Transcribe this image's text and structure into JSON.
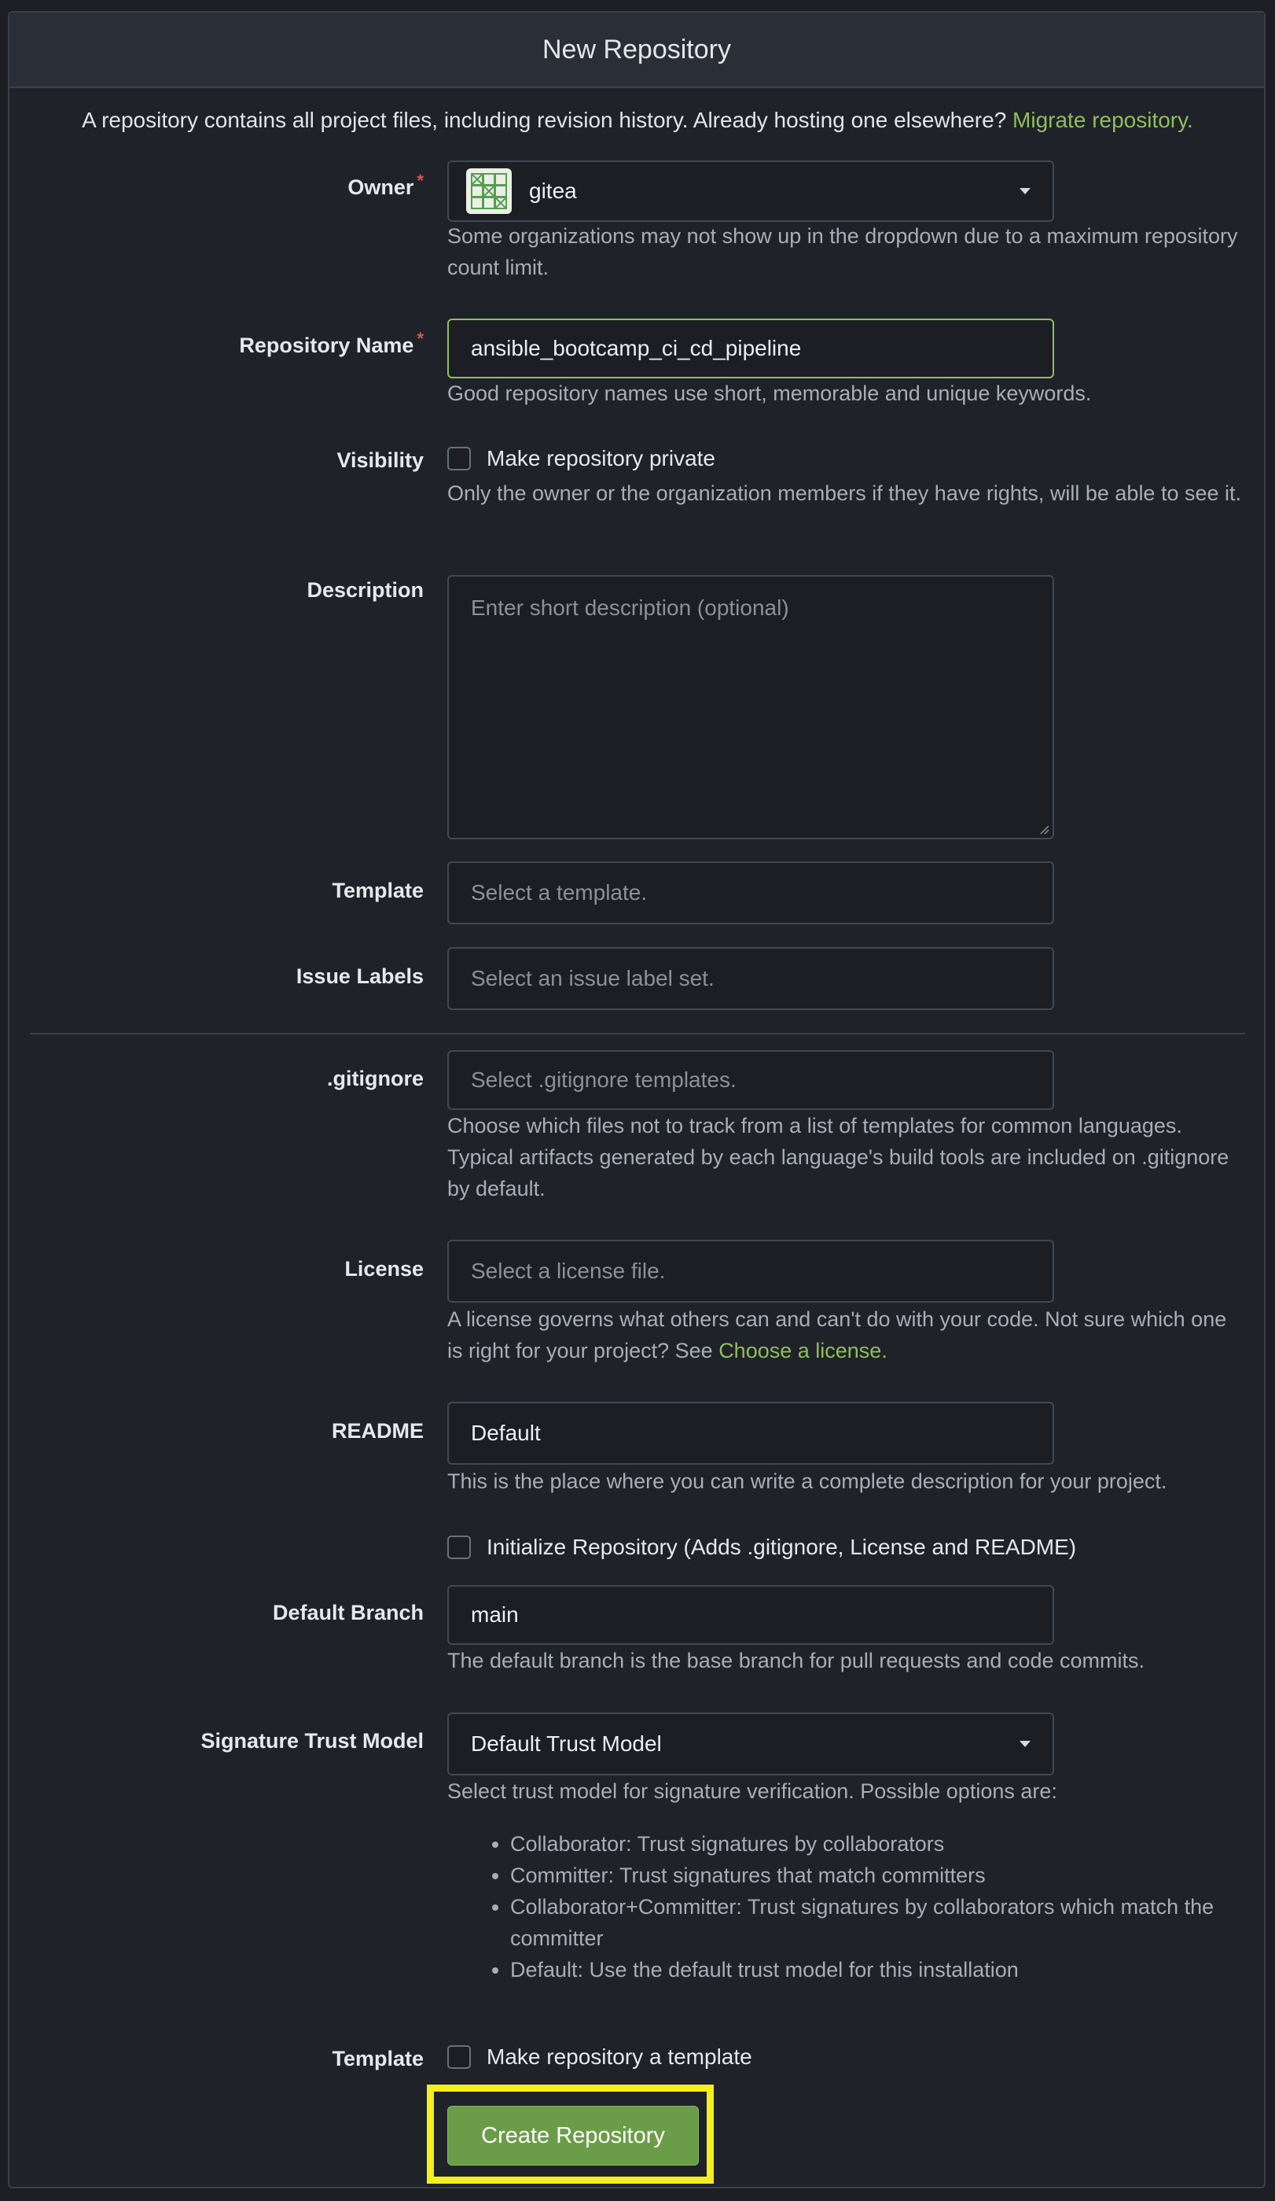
{
  "header": {
    "title": "New Repository"
  },
  "intro": {
    "text": "A repository contains all project files, including revision history. Already hosting one elsewhere?",
    "link": "Migrate repository."
  },
  "owner": {
    "label": "Owner",
    "required_mark": "*",
    "value": "gitea",
    "help": "Some organizations may not show up in the dropdown due to a maximum repository count limit."
  },
  "repo_name": {
    "label": "Repository Name",
    "required_mark": "*",
    "value": "ansible_bootcamp_ci_cd_pipeline",
    "help": "Good repository names use short, memorable and unique keywords."
  },
  "visibility": {
    "label": "Visibility",
    "checkbox_label": "Make repository private",
    "checked": false,
    "help": "Only the owner or the organization members if they have rights, will be able to see it."
  },
  "description": {
    "label": "Description",
    "placeholder": "Enter short description (optional)"
  },
  "template": {
    "label": "Template",
    "placeholder": "Select a template."
  },
  "issue_labels": {
    "label": "Issue Labels",
    "placeholder": "Select an issue label set."
  },
  "gitignore": {
    "label": ".gitignore",
    "placeholder": "Select .gitignore templates.",
    "help": "Choose which files not to track from a list of templates for common languages. Typical artifacts generated by each language's build tools are included on .gitignore by default."
  },
  "license": {
    "label": "License",
    "placeholder": "Select a license file.",
    "help": "A license governs what others can and can't do with your code. Not sure which one is right for your project? See",
    "help_link": "Choose a license."
  },
  "readme": {
    "label": "README",
    "value": "Default",
    "help": "This is the place where you can write a complete description for your project."
  },
  "init_repo": {
    "checkbox_label": "Initialize Repository (Adds .gitignore, License and README)",
    "checked": false
  },
  "default_branch": {
    "label": "Default Branch",
    "value": "main",
    "help": "The default branch is the base branch for pull requests and code commits."
  },
  "trust_model": {
    "label": "Signature Trust Model",
    "value": "Default Trust Model",
    "help": "Select trust model for signature verification. Possible options are:",
    "options": [
      "Collaborator: Trust signatures by collaborators",
      "Committer: Trust signatures that match committers",
      "Collaborator+Committer: Trust signatures by collaborators which match the committer",
      "Default: Use the default trust model for this installation"
    ]
  },
  "make_template": {
    "label": "Template",
    "checkbox_label": "Make repository a template",
    "checked": false
  },
  "submit": {
    "label": "Create Repository"
  },
  "colors": {
    "accent": "#8fbf5a",
    "button": "#6b9d48",
    "highlight": "#f4ee1b",
    "background": "#1f2229"
  },
  "icons": {
    "owner_avatar": "org-avatar-icon",
    "dropdown": "caret-down-icon"
  }
}
